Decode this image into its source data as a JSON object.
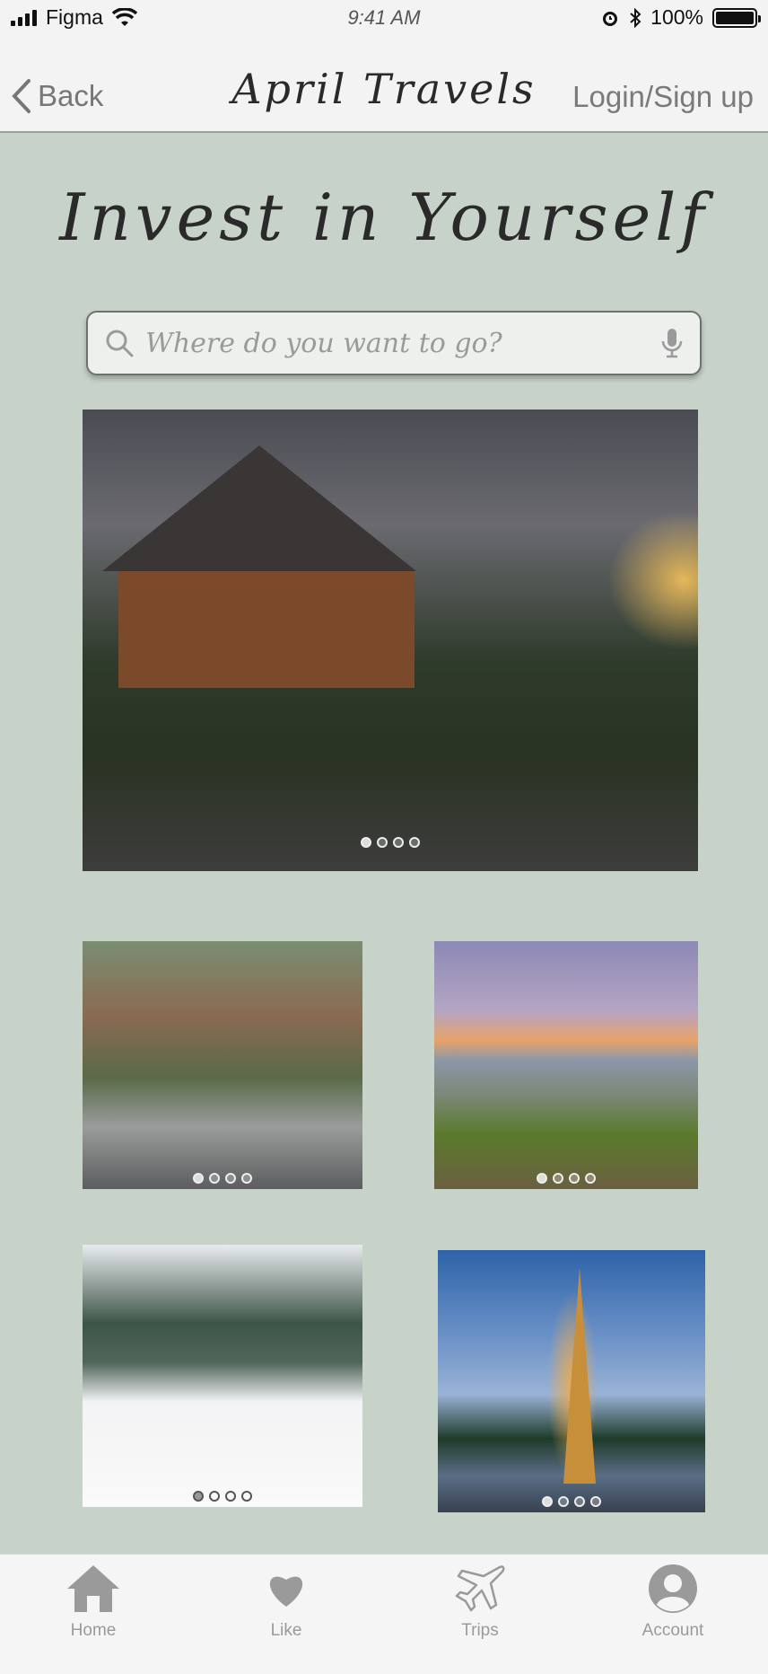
{
  "status_bar": {
    "carrier": "Figma",
    "time": "9:41 AM",
    "battery": "100%"
  },
  "nav": {
    "back_label": "Back",
    "title": "April Travels",
    "login_label": "Login/Sign up"
  },
  "headline": "Invest in Yourself",
  "search": {
    "placeholder": "Where do you want to go?"
  },
  "photos": [
    {
      "id": "family-cabin",
      "dots": 4,
      "active_dot": 0
    },
    {
      "id": "brownstone-street",
      "dots": 4,
      "active_dot": 0
    },
    {
      "id": "coastal-cliff",
      "dots": 4,
      "active_dot": 0
    },
    {
      "id": "snow-cabin",
      "dots": 4,
      "active_dot": 0
    },
    {
      "id": "eiffel-tower",
      "dots": 4,
      "active_dot": 0
    }
  ],
  "tabs": [
    {
      "label": "Home",
      "icon": "home-icon"
    },
    {
      "label": "Like",
      "icon": "heart-icon"
    },
    {
      "label": "Trips",
      "icon": "airplane-icon"
    },
    {
      "label": "Account",
      "icon": "user-icon"
    }
  ],
  "colors": {
    "background": "#c7d3c9",
    "bar": "#f2f3f2",
    "muted_icon": "#9a9a9a"
  }
}
